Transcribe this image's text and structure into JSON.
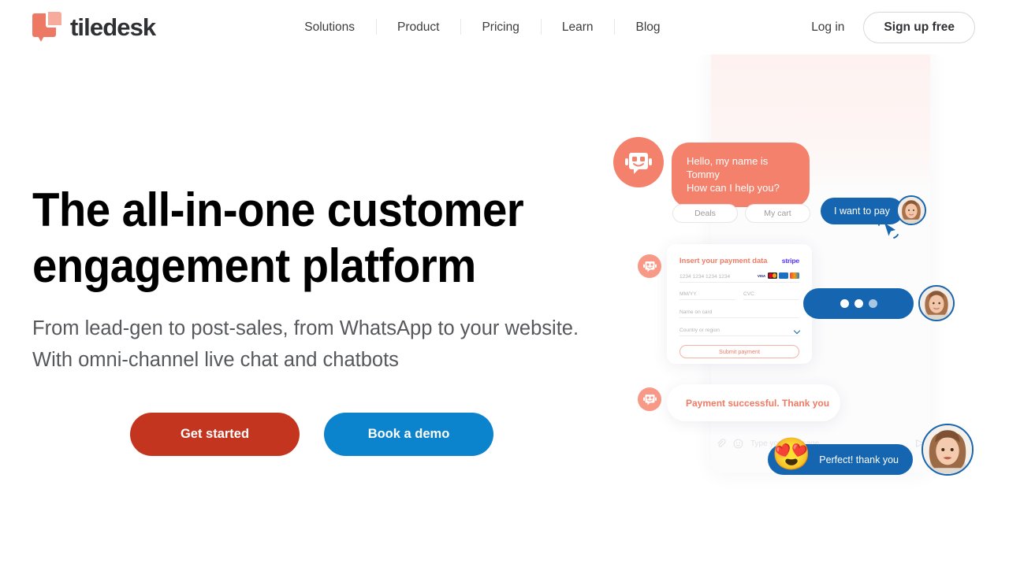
{
  "brand": {
    "name": "tiledesk",
    "logo_icon": "tiledesk-tile-logo",
    "logo_color": "#ed7964",
    "logo_accent_color": "#f6ab9c"
  },
  "header": {
    "nav": [
      {
        "label": "Solutions"
      },
      {
        "label": "Product"
      },
      {
        "label": "Pricing"
      },
      {
        "label": "Learn"
      },
      {
        "label": "Blog"
      }
    ],
    "login_label": "Log in",
    "signup_label": "Sign up free"
  },
  "hero": {
    "title_line1": "The all-in-one customer",
    "title_line2": "engagement platform",
    "subtitle_line1": "From lead-gen to post-sales, from WhatsApp to your",
    "subtitle_line2": "website. With omni-channel live chat and chatbots",
    "cta_primary": "Get started",
    "cta_primary_color": "#c4351f",
    "cta_secondary": "Book a demo",
    "cta_secondary_color": "#0c83cd"
  },
  "chat": {
    "bot_avatar_icon": "robot-face-icon",
    "bot_color": "#f4816c",
    "user_color": "#1565b0",
    "greeting_line1": "Hello, my name is Tommy",
    "greeting_line2": "How can I help you?",
    "quick_replies": [
      {
        "label": "Deals"
      },
      {
        "label": "My cart"
      }
    ],
    "user_pay_message": "I want to pay",
    "cursor_icon": "mouse-click-icon",
    "typing_indicator": "•••",
    "payment_card": {
      "title": "Insert your payment data",
      "provider": "stripe",
      "card_number_placeholder": "1234 1234 1234 1234",
      "expiry_placeholder": "MM/YY",
      "cvc_placeholder": "CVC",
      "name_placeholder": "Name on card",
      "country_placeholder": "Country or region",
      "country_chevron_icon": "chevron-down-icon",
      "submit_label": "Submit payment",
      "card_brands": [
        {
          "name": "visa-icon",
          "label": "VISA"
        },
        {
          "name": "mastercard-icon",
          "label": ""
        },
        {
          "name": "amex-icon",
          "label": ""
        },
        {
          "name": "discover-icon",
          "label": ""
        }
      ]
    },
    "success_message": "Payment successful. Thank you",
    "input_bar": {
      "attach_icon": "paperclip-icon",
      "emoji_icon": "smiley-icon",
      "placeholder": "Type your message",
      "send_icon": "send-icon"
    },
    "final_message": "Perfect! thank you",
    "final_emoji": "😍"
  }
}
